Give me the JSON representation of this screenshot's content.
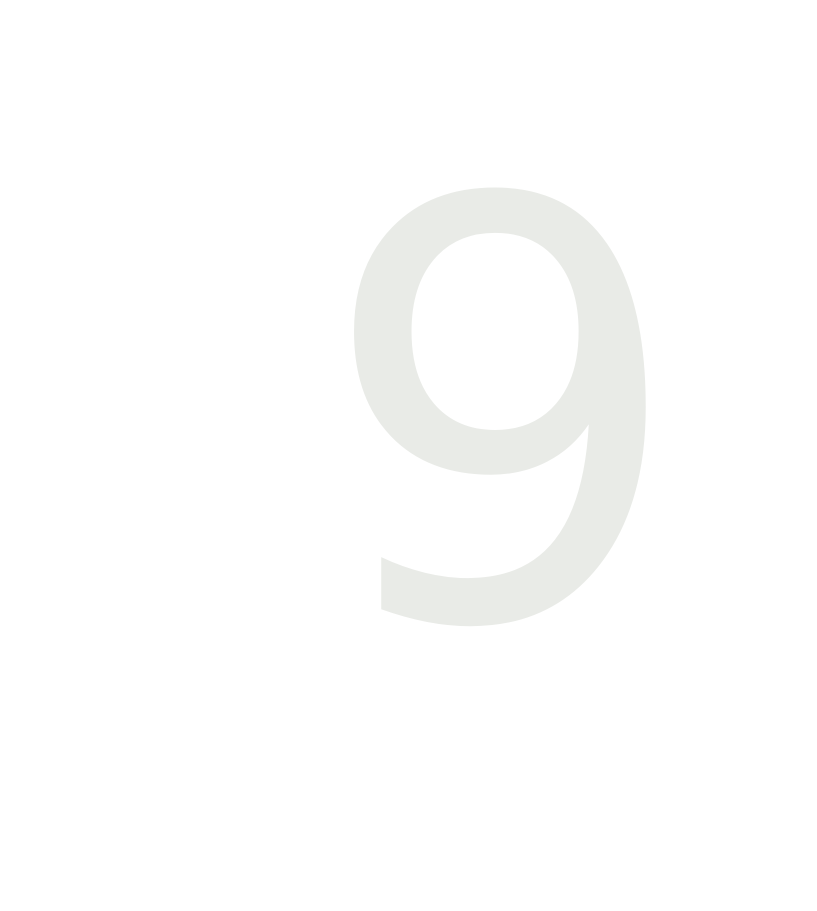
{
  "page": {
    "digit": "9",
    "digit_color": "#e9ebe7",
    "background_color": "#ffffff"
  }
}
